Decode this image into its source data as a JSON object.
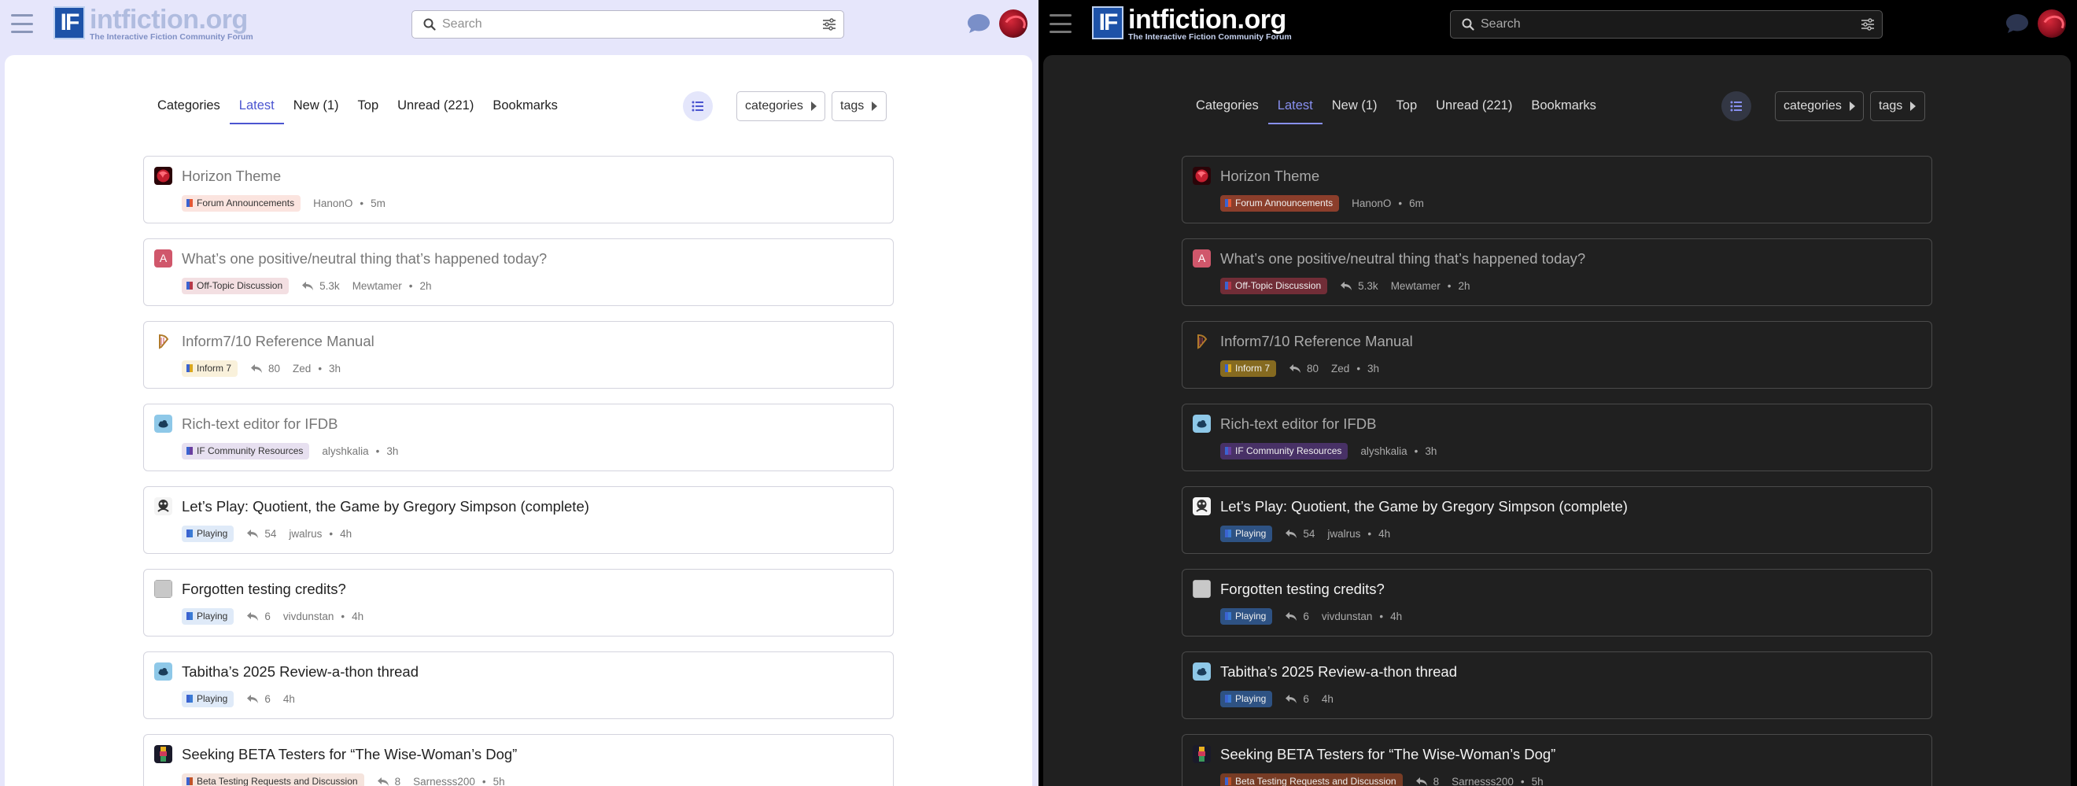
{
  "site": {
    "logo_mark": "IF",
    "logo_title": "intfiction.org",
    "logo_tagline": "The Interactive Fiction Community Forum"
  },
  "search": {
    "placeholder": "Search"
  },
  "nav": {
    "tabs": [
      "Categories",
      "Latest",
      "New (1)",
      "Top",
      "Unread (221)",
      "Bookmarks"
    ],
    "active": "Latest",
    "categories_dropdown": "categories",
    "tags_dropdown": "tags"
  },
  "colors": {
    "light_accent": "#4b55d0",
    "dark_accent": "#8890f0",
    "forum_announcements": "#e45735",
    "off_topic": "#b5384a",
    "inform7": "#d9a820",
    "if_community_resources": "#6a3fa0",
    "playing": "#3a7bd5",
    "beta_testing": "#c0542a"
  },
  "light": {
    "topics": [
      {
        "title": "Horizon Theme",
        "category": "Forum Announcements",
        "replies": "",
        "author": "HanonO",
        "age": "5m",
        "state": "read",
        "avatar": "red-dragon"
      },
      {
        "title": "What’s one positive/neutral thing that’s happened today?",
        "category": "Off-Topic Discussion",
        "replies": "5.3k",
        "author": "Mewtamer",
        "age": "2h",
        "state": "read",
        "avatar": "A"
      },
      {
        "title": "Inform7/10 Reference Manual",
        "category": "Inform 7",
        "replies": "80",
        "author": "Zed",
        "age": "3h",
        "state": "read",
        "avatar": "harp"
      },
      {
        "title": "Rich-text editor for IFDB",
        "category": "IF Community Resources",
        "replies": "",
        "author": "alyshkalia",
        "age": "3h",
        "state": "read",
        "avatar": "cloud"
      },
      {
        "title": "Let’s Play: Quotient, the Game by Gregory Simpson (complete)",
        "category": "Playing",
        "replies": "54",
        "author": "jwalrus",
        "age": "4h",
        "state": "unread",
        "avatar": "walrus"
      },
      {
        "title": "Forgotten testing credits?",
        "category": "Playing",
        "replies": "6",
        "author": "vivdunstan",
        "age": "4h",
        "state": "unread",
        "avatar": "grey"
      },
      {
        "title": "Tabitha’s 2025 Review-a-thon thread",
        "category": "Playing",
        "replies": "6",
        "author": "",
        "age": "4h",
        "state": "unread",
        "avatar": "cloud"
      },
      {
        "title": "Seeking BETA Testers for “The Wise-Woman’s Dog”",
        "category": "Beta Testing Requests and Discussion",
        "replies": "8",
        "author": "Sarnesss200",
        "age": "5h",
        "state": "unread",
        "avatar": "totem"
      }
    ]
  },
  "dark": {
    "topics": [
      {
        "title": "Horizon Theme",
        "category": "Forum Announcements",
        "replies": "",
        "author": "HanonO",
        "age": "6m",
        "state": "read",
        "avatar": "red-dragon"
      },
      {
        "title": "What’s one positive/neutral thing that’s happened today?",
        "category": "Off-Topic Discussion",
        "replies": "5.3k",
        "author": "Mewtamer",
        "age": "2h",
        "state": "read",
        "avatar": "A"
      },
      {
        "title": "Inform7/10 Reference Manual",
        "category": "Inform 7",
        "replies": "80",
        "author": "Zed",
        "age": "3h",
        "state": "read",
        "avatar": "harp"
      },
      {
        "title": "Rich-text editor for IFDB",
        "category": "IF Community Resources",
        "replies": "",
        "author": "alyshkalia",
        "age": "3h",
        "state": "read",
        "avatar": "cloud"
      },
      {
        "title": "Let’s Play: Quotient, the Game by Gregory Simpson (complete)",
        "category": "Playing",
        "replies": "54",
        "author": "jwalrus",
        "age": "4h",
        "state": "unread",
        "avatar": "walrus"
      },
      {
        "title": "Forgotten testing credits?",
        "category": "Playing",
        "replies": "6",
        "author": "vivdunstan",
        "age": "4h",
        "state": "unread",
        "avatar": "grey"
      },
      {
        "title": "Tabitha’s 2025 Review-a-thon thread",
        "category": "Playing",
        "replies": "6",
        "author": "",
        "age": "4h",
        "state": "unread",
        "avatar": "cloud"
      },
      {
        "title": "Seeking BETA Testers for “The Wise-Woman’s Dog”",
        "category": "Beta Testing Requests and Discussion",
        "replies": "8",
        "author": "Sarnesss200",
        "age": "5h",
        "state": "unread",
        "avatar": "totem"
      }
    ]
  }
}
